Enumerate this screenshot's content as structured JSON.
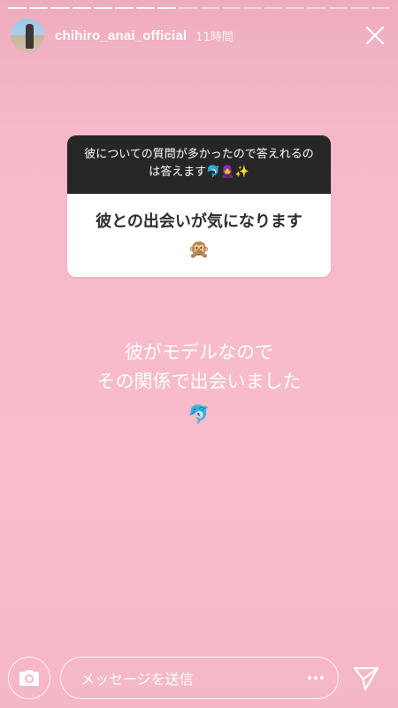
{
  "story": {
    "segments_total": 18,
    "segments_viewed": 8
  },
  "header": {
    "username": "chihiro_anai_official",
    "time": "11時間"
  },
  "question": {
    "prompt": "彼についての質問が多かったので答えれるのは答えます🐬🧕✨",
    "text": "彼との出会いが気になります",
    "emoji": "🙊"
  },
  "answer": {
    "line1": "彼がモデルなので",
    "line2": "その関係で出会いました",
    "emoji": "🐬"
  },
  "reply": {
    "placeholder": "メッセージを送信"
  },
  "icons": {
    "close": "close-icon",
    "camera": "camera-icon",
    "more": "more-dots-icon",
    "send": "send-icon"
  }
}
